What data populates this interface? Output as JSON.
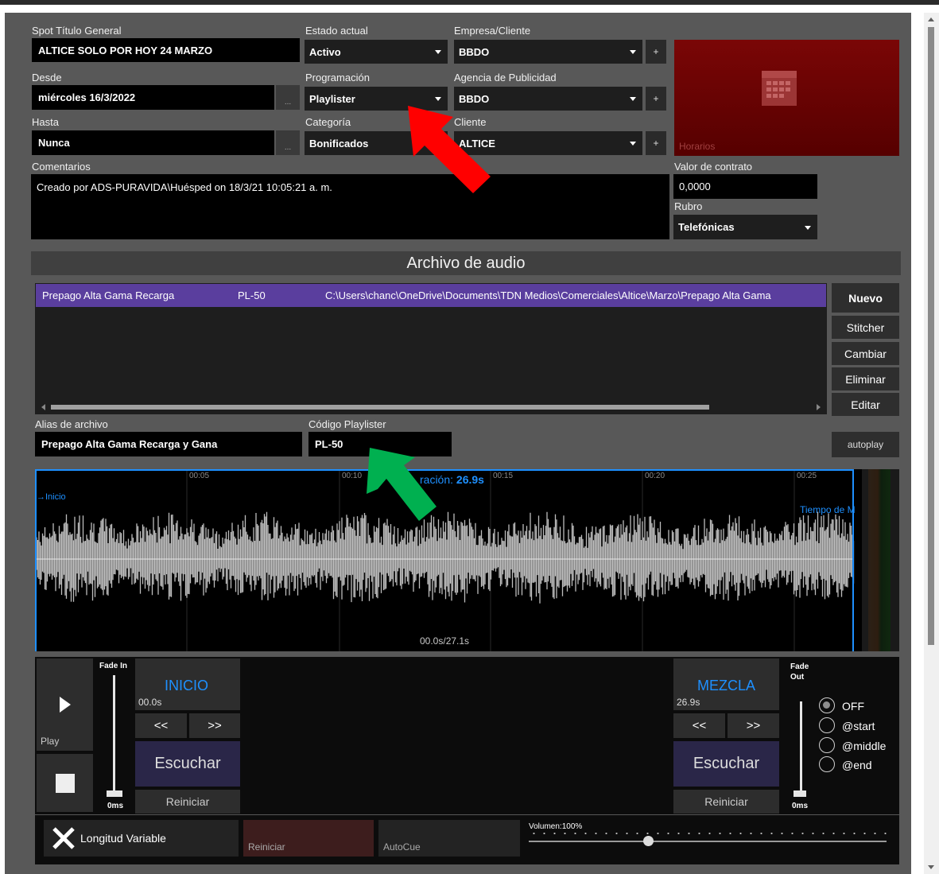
{
  "form": {
    "spot_title_label": "Spot Título General",
    "spot_title_value": "ALTICE SOLO POR HOY 24 MARZO",
    "status_label": "Estado actual",
    "status_value": "Activo",
    "company_label": "Empresa/Cliente",
    "company_value": "BBDO",
    "from_label": "Desde",
    "from_value": "miércoles 16/3/2022",
    "programming_label": "Programación",
    "programming_value": "Playlister",
    "agency_label": "Agencia de Publicidad",
    "agency_value": "BBDO",
    "until_label": "Hasta",
    "until_value": "Nunca",
    "category_label": "Categoría",
    "category_value": "Bonificados",
    "client_label": "Cliente",
    "client_value": "ALTICE",
    "comments_label": "Comentarios",
    "comments_value": "Creado por ADS-PURAVIDA\\Huésped on 18/3/21 10:05:21 a. m.",
    "contract_label": "Valor de contrato",
    "contract_value": "0,0000",
    "rubro_label": "Rubro",
    "rubro_value": "Telefónicas",
    "schedule_label": "Horarios",
    "ellipsis": "...",
    "plus": "+"
  },
  "audio": {
    "section_title": "Archivo de audio",
    "files": [
      {
        "name": "Prepago Alta Gama Recarga",
        "code": "PL-50",
        "path": "C:\\Users\\chanc\\OneDrive\\Documents\\TDN Medios\\Comerciales\\Altice\\Marzo\\Prepago Alta Gama"
      }
    ],
    "buttons": {
      "new": "Nuevo",
      "stitcher": "Stitcher",
      "change": "Cambiar",
      "delete": "Eliminar",
      "edit": "Editar",
      "autoplay": "autoplay"
    },
    "alias_label": "Alias de archivo",
    "alias_value": "Prepago Alta Gama Recarga y Gana",
    "code_label": "Código Playlister",
    "code_value": "PL-50"
  },
  "waveform": {
    "ticks": [
      "00:05",
      "00:10",
      "00:15",
      "00:20",
      "00:25"
    ],
    "start_marker": "Inicio",
    "duration_label": "ración:",
    "duration_value": "26.9s",
    "mix_time_label": "Tiempo de M",
    "position": "00.0s/27.1s"
  },
  "controls": {
    "play_label": "Play",
    "fade_in_label": "Fade In",
    "fade_in_value": "0ms",
    "inicio_title": "INICIO",
    "inicio_time": "00.0s",
    "prev": "<<",
    "next": ">>",
    "listen": "Escuchar",
    "reset": "Reiniciar",
    "mix_title": "MEZCLA",
    "mix_time": "26.9s",
    "fade_out_label": "Fade\nOut",
    "fade_out_value": "0ms",
    "fade_options": [
      "OFF",
      "@start",
      "@middle",
      "@end"
    ],
    "fade_selected": "OFF",
    "variable_length": "Longitud Variable",
    "reset2": "Reiniciar",
    "autocue": "AutoCue",
    "volume_label": "Volumen:100%",
    "volume_level": 1.0
  },
  "colors": {
    "accent_blue": "#1e90ff",
    "selection_purple": "#5a3e9e",
    "schedule_red": "#6b0000",
    "arrow_red": "#ff0000",
    "arrow_green": "#00b050"
  }
}
